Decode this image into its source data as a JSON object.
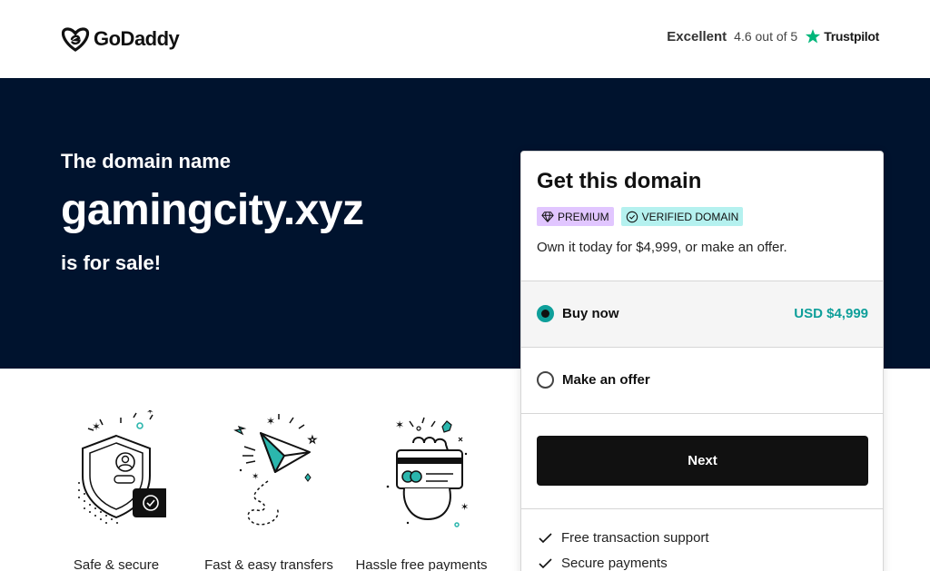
{
  "header": {
    "brand": "GoDaddy",
    "rating_label": "Excellent",
    "rating_score": "4.6 out of 5",
    "rating_source": "Trustpilot"
  },
  "hero": {
    "pre_text": "The domain name",
    "domain": "gamingcity.xyz",
    "post_text": "is for sale!"
  },
  "card": {
    "title": "Get this domain",
    "badges": [
      "PREMIUM",
      "VERIFIED DOMAIN"
    ],
    "offer_text": "Own it today for $4,999, or make an offer.",
    "options": [
      {
        "label": "Buy now",
        "price": "USD $4,999",
        "selected": true
      },
      {
        "label": "Make an offer",
        "selected": false
      }
    ],
    "next_label": "Next",
    "benefits": [
      "Free transaction support",
      "Secure payments"
    ]
  },
  "features": [
    {
      "label": "Safe & secure",
      "icon": "shield-icon"
    },
    {
      "label": "Fast & easy transfers",
      "icon": "paper-plane-icon"
    },
    {
      "label": "Hassle free payments",
      "icon": "card-hand-icon"
    }
  ],
  "colors": {
    "hero_bg": "#00132e",
    "accent_teal": "#0e9f9a",
    "premium_badge": "#e1c6ff",
    "verified_badge": "#b5f1ef",
    "trustpilot_green": "#00b67a",
    "button_bg": "#111111"
  }
}
